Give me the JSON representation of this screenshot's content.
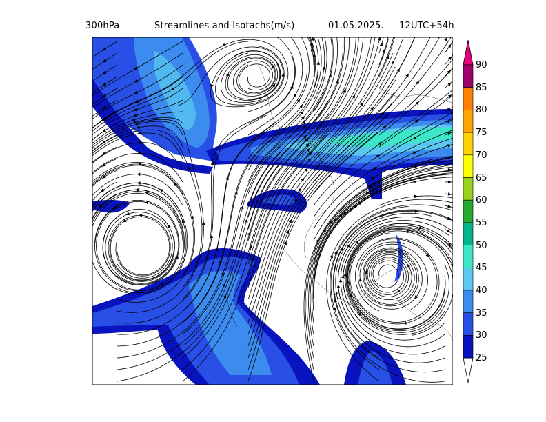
{
  "header": {
    "level": "300hPa",
    "title": "Streamlines and Isotachs(m/s)",
    "date": "01.05.2025.",
    "run": "12UTC+54h"
  },
  "legend": {
    "levels": [
      "90",
      "85",
      "80",
      "75",
      "70",
      "65",
      "60",
      "55",
      "50",
      "45",
      "40",
      "35",
      "30",
      "25"
    ],
    "colors": [
      "#e6007e",
      "#a0006e",
      "#ff7f00",
      "#ffa500",
      "#ffd200",
      "#ffff00",
      "#9bd21e",
      "#28aa32",
      "#00b48c",
      "#3ce6c8",
      "#5ac8f0",
      "#3c8cf0",
      "#2850e6",
      "#0a14be"
    ]
  }
}
